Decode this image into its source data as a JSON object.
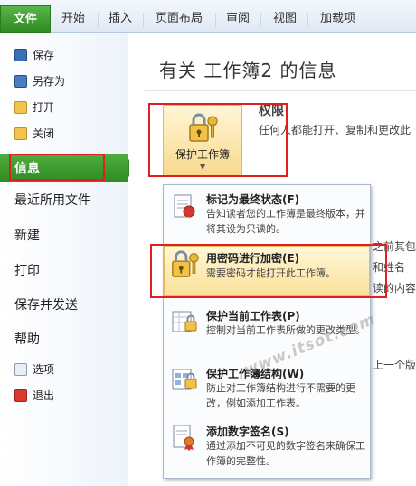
{
  "ribbon": {
    "tabs": [
      "文件",
      "开始",
      "插入",
      "页面布局",
      "审阅",
      "视图",
      "加载项"
    ]
  },
  "sidebar": {
    "small_items": [
      {
        "label": "保存",
        "icon": "save-icon"
      },
      {
        "label": "另存为",
        "icon": "save-as-icon"
      },
      {
        "label": "打开",
        "icon": "open-folder-icon"
      },
      {
        "label": "关闭",
        "icon": "close-document-icon"
      }
    ],
    "active": "信息",
    "big_items": [
      "最近所用文件",
      "新建",
      "打印",
      "保存并发送",
      "帮助"
    ],
    "bottom_items": [
      {
        "label": "选项",
        "icon": "options-icon"
      },
      {
        "label": "退出",
        "icon": "exit-icon"
      }
    ]
  },
  "main": {
    "title": "有关 工作簿2 的信息",
    "protect_button": "保护工作簿",
    "permissions": {
      "title": "权限",
      "desc": "任何人都能打开、复制和更改此"
    },
    "background_fragments": [
      "之前其包含",
      "和姓名",
      "读的内容",
      "上一个版本"
    ]
  },
  "menu": {
    "items": [
      {
        "title": "标记为最终状态(F)",
        "desc": "告知读者您的工作簿是最终版本，并将其设为只读的。",
        "icon": "mark-final-icon"
      },
      {
        "title": "用密码进行加密(E)",
        "desc": "需要密码才能打开此工作簿。",
        "icon": "encrypt-lock-icon"
      },
      {
        "title": "保护当前工作表(P)",
        "desc": "控制对当前工作表所做的更改类型。",
        "icon": "protect-sheet-icon"
      },
      {
        "title": "保护工作簿结构(W)",
        "desc": "防止对工作簿结构进行不需要的更改，例如添加工作表。",
        "icon": "protect-structure-icon"
      },
      {
        "title": "添加数字签名(S)",
        "desc": "通过添加不可见的数字签名来确保工作簿的完整性。",
        "icon": "digital-signature-icon"
      }
    ]
  },
  "watermark": "www.itsot.com",
  "colors": {
    "file_tab": "#2f8a22",
    "active_item": "#2f8a22",
    "highlight": "#fbe19a",
    "annotation_red": "#e02020"
  }
}
